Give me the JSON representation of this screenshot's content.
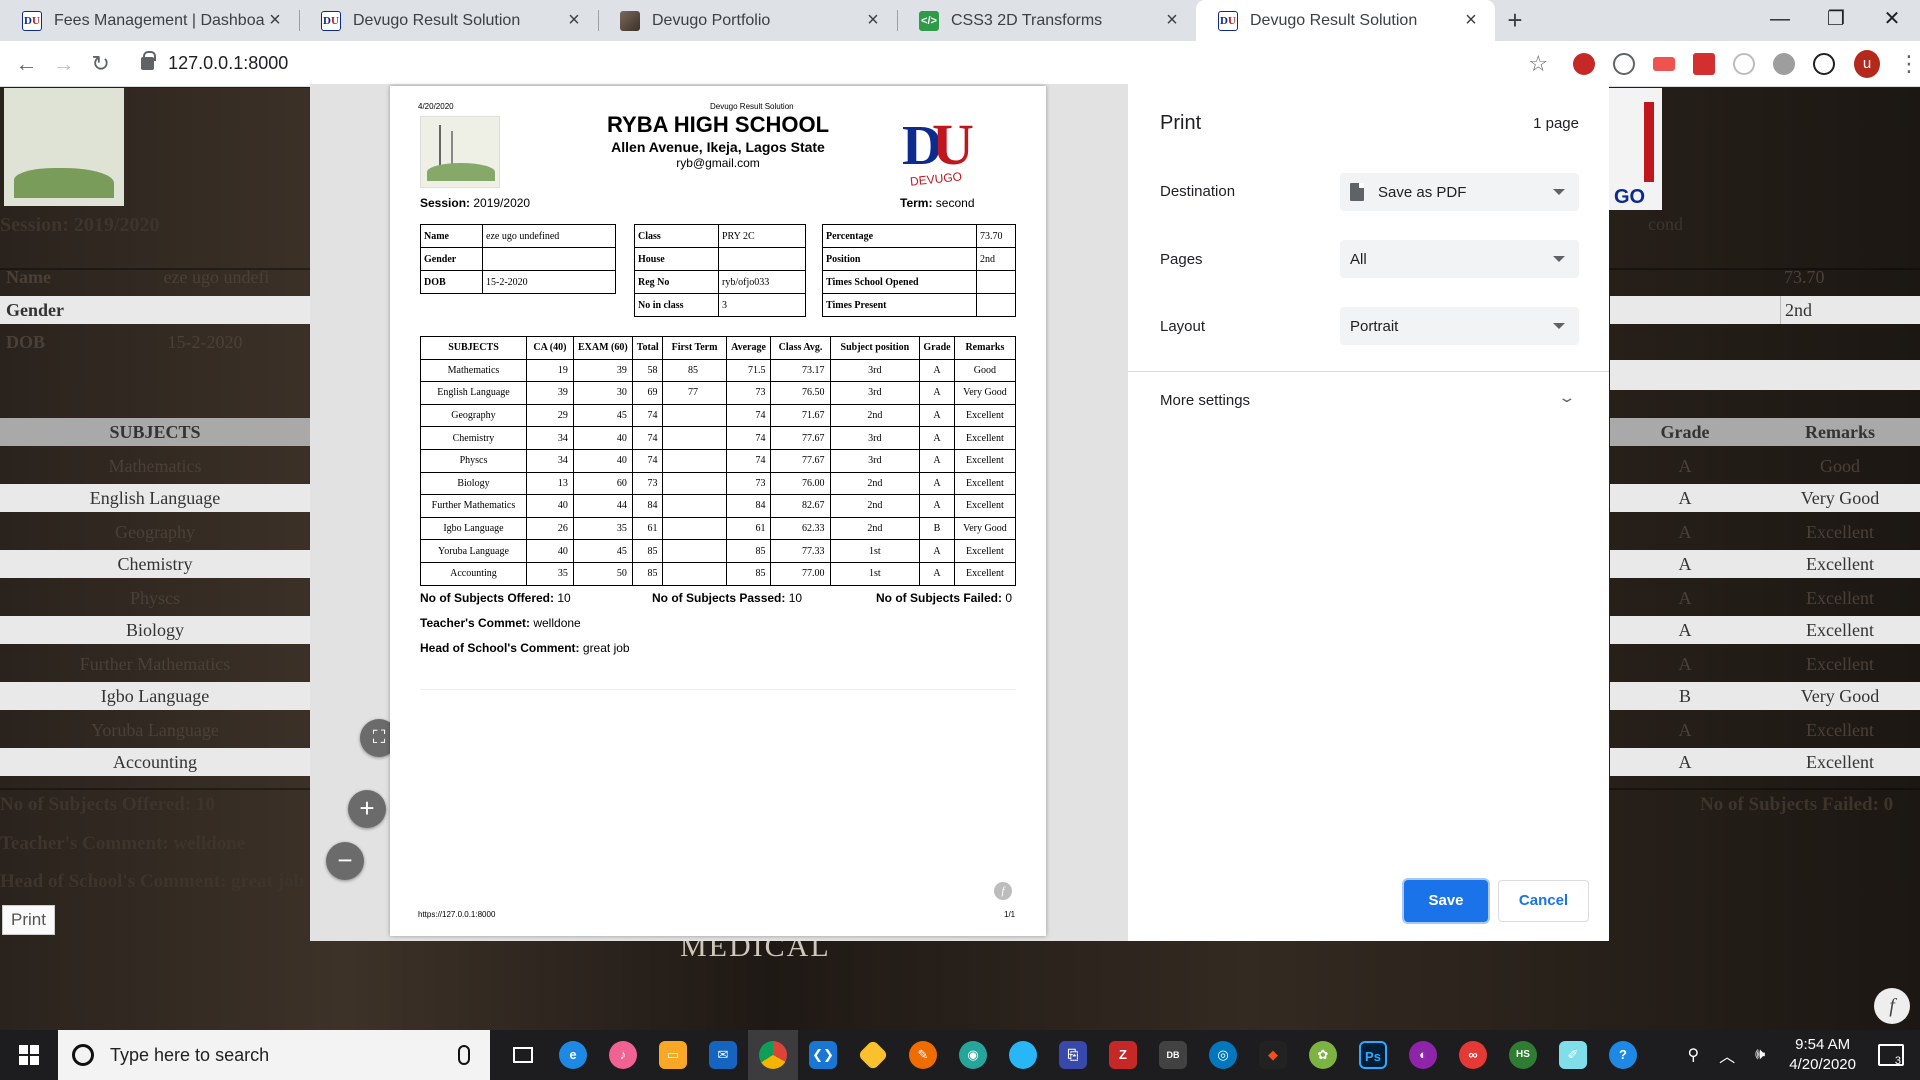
{
  "browser": {
    "tabs": [
      {
        "title": "Fees Management | Dashboard",
        "favicon": "du-logo",
        "active": false
      },
      {
        "title": "Devugo Result Solution",
        "favicon": "du-logo",
        "active": false
      },
      {
        "title": "Devugo Portfolio",
        "favicon": "photo",
        "active": false
      },
      {
        "title": "CSS3 2D Transforms",
        "favicon": "css",
        "active": false
      },
      {
        "title": "Devugo Result Solution",
        "favicon": "du-logo",
        "active": true
      }
    ],
    "url": "127.0.0.1:8000"
  },
  "background_page": {
    "session": "Session: 2019/2020",
    "name_label": "Name",
    "name_value": "eze ugo undefi",
    "gender_label": "Gender",
    "dob_label": "DOB",
    "dob_value": "15-2-2020",
    "subjects_header": "SUBJECTS",
    "subjects": [
      "Mathematics",
      "English Language",
      "Geography",
      "Chemistry",
      "Physcs",
      "Biology",
      "Further Mathematics",
      "Igbo Language",
      "Yoruba Language",
      "Accounting"
    ],
    "percentage_value": "73.70",
    "position_value": "2nd",
    "grade_header": "Grade",
    "remarks_header": "Remarks",
    "grades": [
      "A",
      "A",
      "A",
      "A",
      "A",
      "A",
      "A",
      "B",
      "A",
      "A"
    ],
    "remarks": [
      "Good",
      "Very Good",
      "Excellent",
      "Excellent",
      "Excellent",
      "Excellent",
      "Excellent",
      "Very Good",
      "Excellent",
      "Excellent"
    ],
    "offered": "No of Subjects Offered: 10",
    "failed": "No of Subjects Failed: 0",
    "teacher": "Teacher's Comment: welldone",
    "head": "Head of School's Comment: great job",
    "print_button": "Print",
    "logo_fragment": "GO",
    "term_fragment": "cond",
    "medical": "MEDICAL"
  },
  "report": {
    "date": "4/20/2020",
    "header_small": "Devugo Result Solution",
    "school_name": "RYBA HIGH SCHOOL",
    "address": "Allen Avenue, Ikeja, Lagos State",
    "email": "ryb@gmail.com",
    "logo_text": "DEVUGO",
    "session_label": "Session:",
    "session_value": "2019/2020",
    "term_label": "Term:",
    "term_value": "second",
    "student": {
      "name_label": "Name",
      "name": "eze ugo undefined",
      "gender_label": "Gender",
      "gender": "",
      "dob_label": "DOB",
      "dob": "15-2-2020"
    },
    "klass": {
      "class_label": "Class",
      "class": "PRY 2C",
      "house_label": "House",
      "house": "",
      "reg_label": "Reg No",
      "reg": "ryb/ofjo033",
      "count_label": "No in class",
      "count": "3"
    },
    "stats": {
      "pct_label": "Percentage",
      "pct": "73.70",
      "pos_label": "Position",
      "pos": "2nd",
      "opened_label": "Times School Opened",
      "opened": "",
      "present_label": "Times Present",
      "present": ""
    },
    "columns": [
      "SUBJECTS",
      "CA (40)",
      "EXAM (60)",
      "Total",
      "First Term",
      "Average",
      "Class Avg.",
      "Subject position",
      "Grade",
      "Remarks"
    ],
    "rows": [
      [
        "Mathematics",
        "19",
        "39",
        "58",
        "85",
        "71.5",
        "73.17",
        "3rd",
        "A",
        "Good"
      ],
      [
        "English Language",
        "39",
        "30",
        "69",
        "77",
        "73",
        "76.50",
        "3rd",
        "A",
        "Very Good"
      ],
      [
        "Geography",
        "29",
        "45",
        "74",
        "",
        "74",
        "71.67",
        "2nd",
        "A",
        "Excellent"
      ],
      [
        "Chemistry",
        "34",
        "40",
        "74",
        "",
        "74",
        "77.67",
        "3rd",
        "A",
        "Excellent"
      ],
      [
        "Physcs",
        "34",
        "40",
        "74",
        "",
        "74",
        "77.67",
        "3rd",
        "A",
        "Excellent"
      ],
      [
        "Biology",
        "13",
        "60",
        "73",
        "",
        "73",
        "76.00",
        "2nd",
        "A",
        "Excellent"
      ],
      [
        "Further Mathematics",
        "40",
        "44",
        "84",
        "",
        "84",
        "82.67",
        "2nd",
        "A",
        "Excellent"
      ],
      [
        "Igbo Language",
        "26",
        "35",
        "61",
        "",
        "61",
        "62.33",
        "2nd",
        "B",
        "Very Good"
      ],
      [
        "Yoruba Language",
        "40",
        "45",
        "85",
        "",
        "85",
        "77.33",
        "1st",
        "A",
        "Excellent"
      ],
      [
        "Accounting",
        "35",
        "50",
        "85",
        "",
        "85",
        "77.00",
        "1st",
        "A",
        "Excellent"
      ]
    ],
    "offered_label": "No of Subjects Offered:",
    "offered": "10",
    "passed_label": "No of Subjects Passed:",
    "passed": "10",
    "failed_label": "No of Subjects Failed:",
    "failed": "0",
    "teacher_label": "Teacher's Commet:",
    "teacher": "welldone",
    "head_label": "Head of School's Comment:",
    "head": "great job",
    "footer_url": "https://127.0.0.1:8000",
    "footer_page": "1/1"
  },
  "print_dialog": {
    "title": "Print",
    "page_count": "1 page",
    "destination_label": "Destination",
    "destination_value": "Save as PDF",
    "pages_label": "Pages",
    "pages_value": "All",
    "layout_label": "Layout",
    "layout_value": "Portrait",
    "more_settings": "More settings",
    "save": "Save",
    "cancel": "Cancel"
  },
  "taskbar": {
    "search_placeholder": "Type here to search",
    "time": "9:54 AM",
    "date": "4/20/2020",
    "notifications": "3"
  },
  "colors": {
    "accent": "#1a73e8",
    "brand_blue": "#0d2a8f",
    "brand_red": "#c0171f"
  }
}
